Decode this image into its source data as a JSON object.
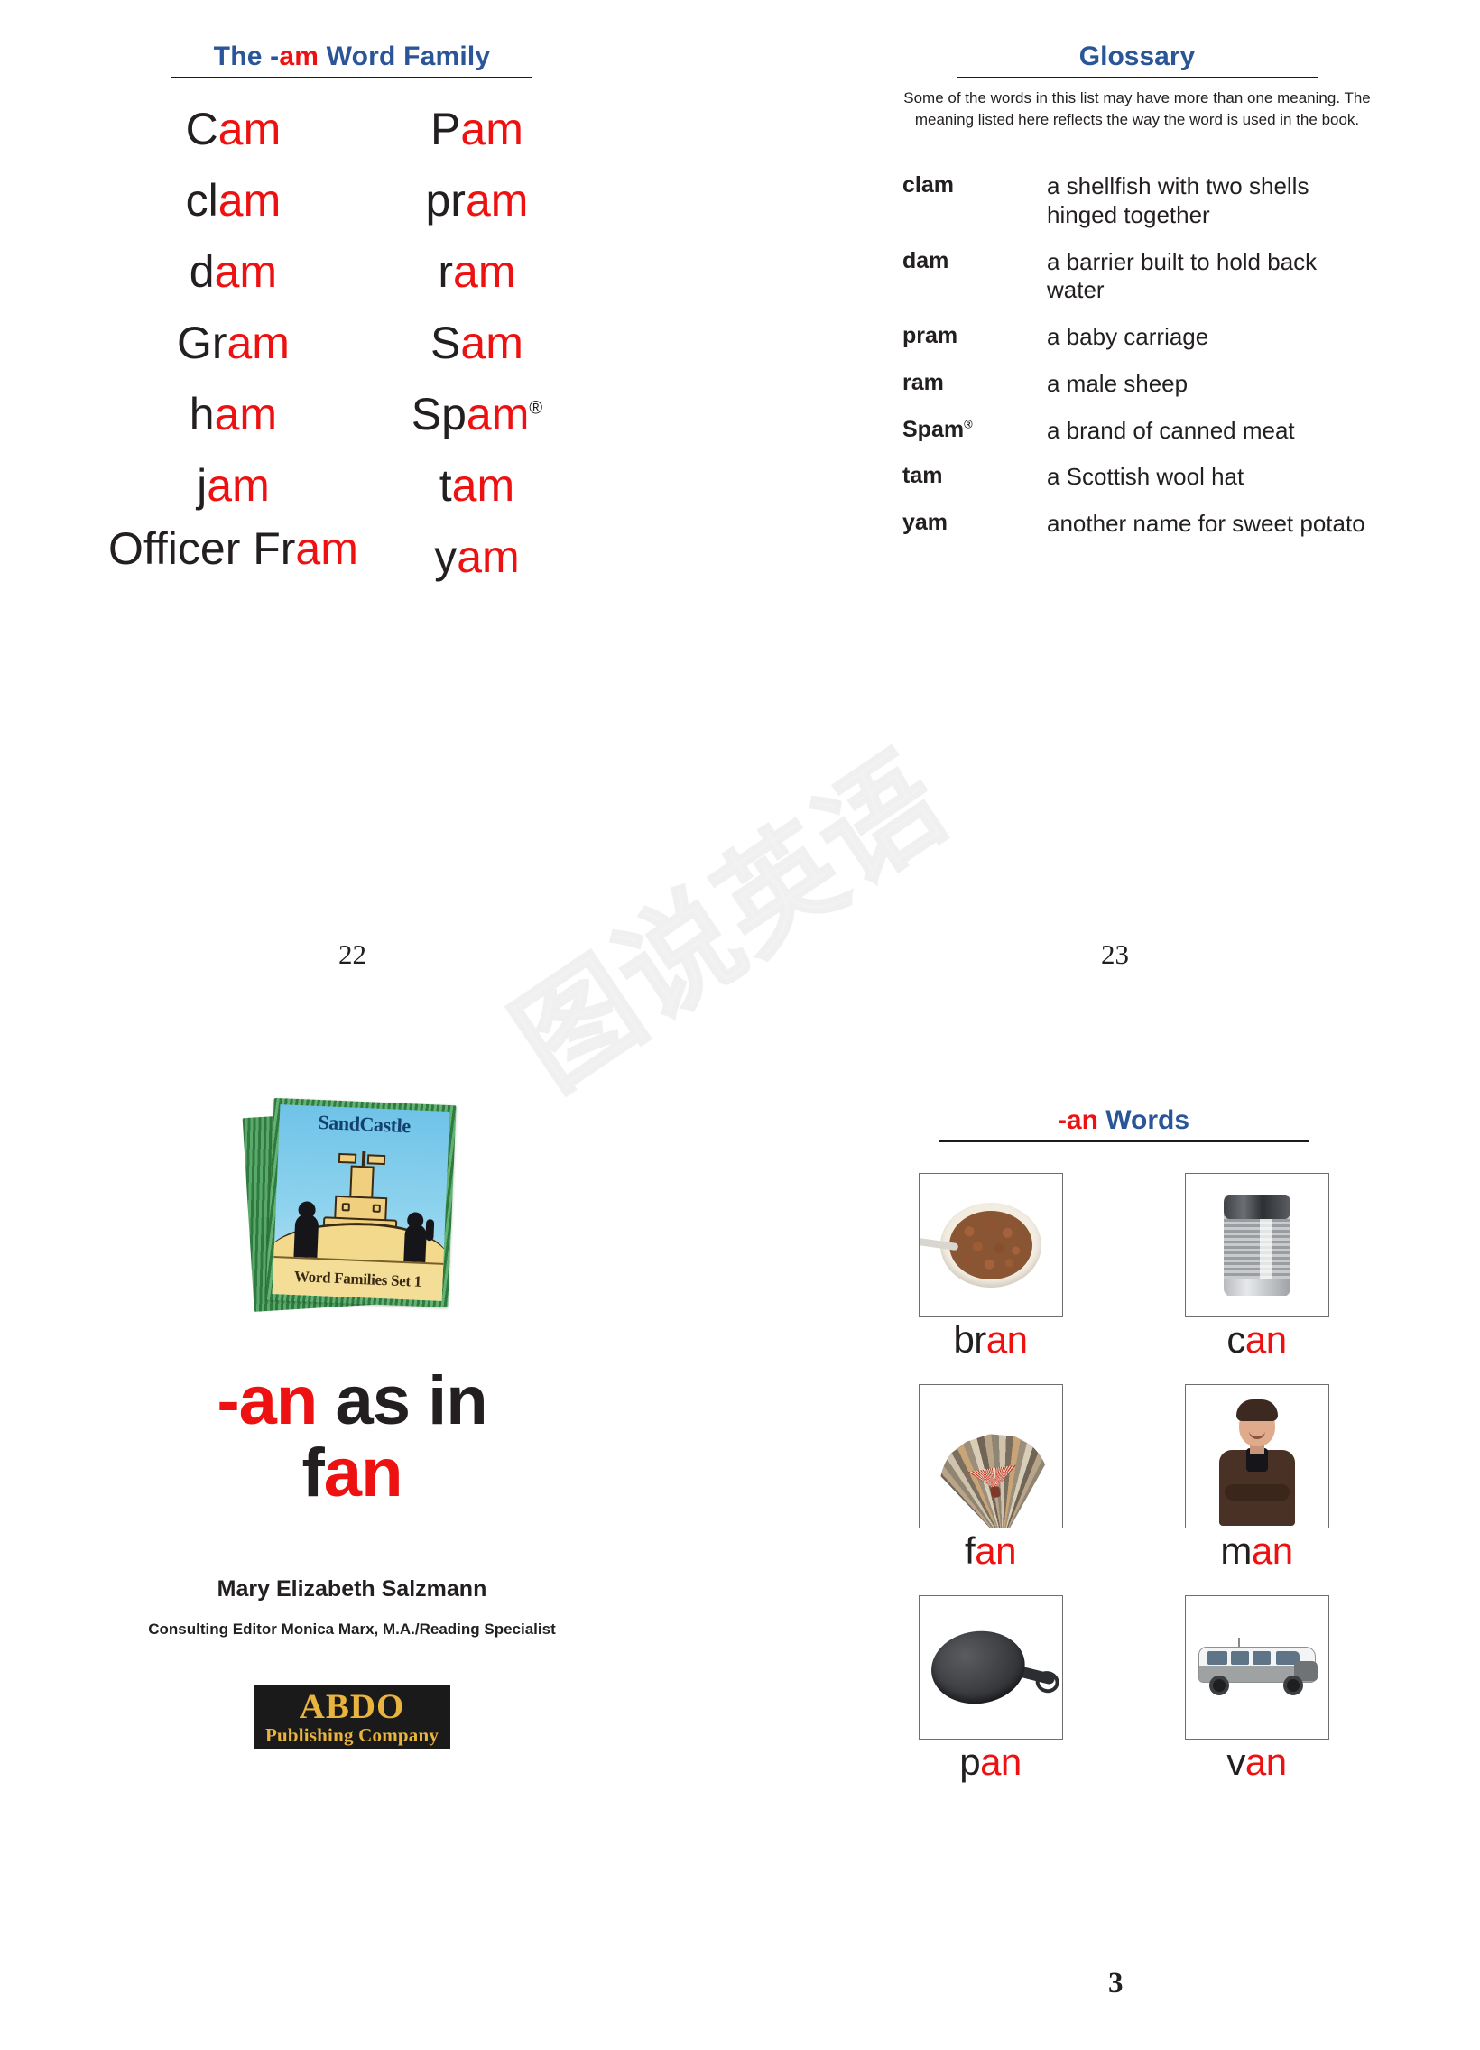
{
  "watermark": {
    "text": "图说英语"
  },
  "colors": {
    "red": "#ee1111",
    "blue": "#2a5699",
    "black": "#231f20",
    "gold": "#e8b33f"
  },
  "page_22": {
    "folio": "22",
    "word_family": {
      "title_prefix": "The -",
      "title_rime": "am",
      "title_suffix": " Word Family",
      "words": [
        {
          "onset": "C",
          "rime": "am",
          "trademark": ""
        },
        {
          "onset": "P",
          "rime": "am",
          "trademark": ""
        },
        {
          "onset": "cl",
          "rime": "am",
          "trademark": ""
        },
        {
          "onset": "pr",
          "rime": "am",
          "trademark": ""
        },
        {
          "onset": "d",
          "rime": "am",
          "trademark": ""
        },
        {
          "onset": "r",
          "rime": "am",
          "trademark": ""
        },
        {
          "onset": "Gr",
          "rime": "am",
          "trademark": ""
        },
        {
          "onset": "S",
          "rime": "am",
          "trademark": ""
        },
        {
          "onset": "h",
          "rime": "am",
          "trademark": ""
        },
        {
          "onset": "Sp",
          "rime": "am",
          "trademark": "®"
        },
        {
          "onset": "j",
          "rime": "am",
          "trademark": ""
        },
        {
          "onset": "t",
          "rime": "am",
          "trademark": ""
        },
        {
          "onset": "Officer Fr",
          "rime": "am",
          "trademark": ""
        },
        {
          "onset": "y",
          "rime": "am",
          "trademark": ""
        }
      ]
    }
  },
  "page_23": {
    "folio": "23",
    "glossary": {
      "title": "Glossary",
      "intro": "Some of the words in this list may have more than one meaning. The meaning listed here reflects the way the word is used in the book.",
      "entries": [
        {
          "term": "clam",
          "trademark": "",
          "definition": "a shellfish with two shells hinged together"
        },
        {
          "term": "dam",
          "trademark": "",
          "definition": "a barrier built to hold back water"
        },
        {
          "term": "pram",
          "trademark": "",
          "definition": "a baby carriage"
        },
        {
          "term": "ram",
          "trademark": "",
          "definition": "a male sheep"
        },
        {
          "term": "Spam",
          "trademark": "®",
          "definition": "a brand of canned meat"
        },
        {
          "term": "tam",
          "trademark": "",
          "definition": "a Scottish wool hat"
        },
        {
          "term": "yam",
          "trademark": "",
          "definition": "another name for sweet potato"
        }
      ]
    }
  },
  "title_page": {
    "cover": {
      "brand": "SandCastle",
      "series": "Word Families Set 1"
    },
    "headline": {
      "rime": "-an",
      "middle": " as in ",
      "word_onset": "f",
      "word_rime": "an"
    },
    "author": "Mary Elizabeth Salzmann",
    "editor": "Consulting Editor Monica Marx, M.A./Reading Specialist",
    "publisher": {
      "name": "ABDO",
      "tagline": "Publishing Company"
    }
  },
  "an_words": {
    "title_rime": "-an",
    "title_suffix": " Words",
    "cards": [
      {
        "onset": "br",
        "rime": "an",
        "picture": "bowl-of-bran-cereal"
      },
      {
        "onset": "c",
        "rime": "an",
        "picture": "tin-can"
      },
      {
        "onset": "f",
        "rime": "an",
        "picture": "folding-hand-fan"
      },
      {
        "onset": "m",
        "rime": "an",
        "picture": "smiling-man"
      },
      {
        "onset": "p",
        "rime": "an",
        "picture": "cast-iron-frying-pan"
      },
      {
        "onset": "v",
        "rime": "an",
        "picture": "white-passenger-van"
      }
    ]
  },
  "book_folio": "3"
}
